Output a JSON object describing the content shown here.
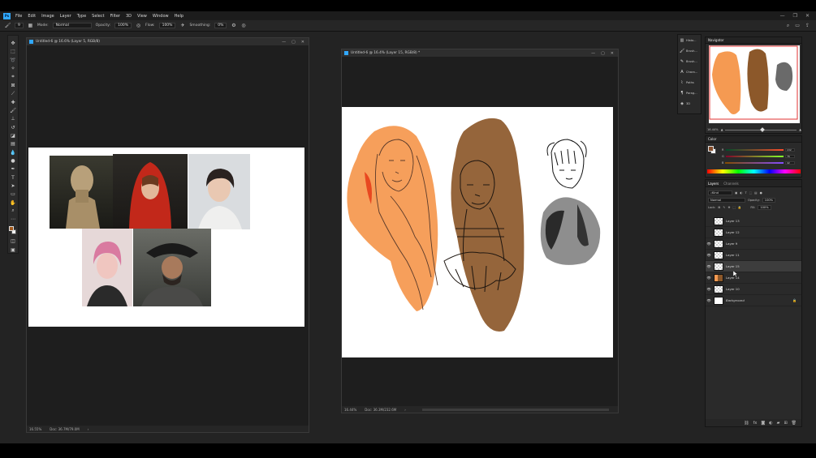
{
  "app": {
    "logo": "Ps",
    "menu": [
      "File",
      "Edit",
      "Image",
      "Layer",
      "Type",
      "Select",
      "Filter",
      "3D",
      "View",
      "Window",
      "Help"
    ],
    "window_controls": [
      "—",
      "❐",
      "✕"
    ]
  },
  "options_bar": {
    "brush_size": "9",
    "mode_label": "Mode:",
    "mode_value": "Normal",
    "opacity_label": "Opacity:",
    "opacity_value": "100%",
    "flow_label": "Flow:",
    "flow_value": "100%",
    "smoothing_label": "Smoothing:",
    "smoothing_value": "0%"
  },
  "doc1": {
    "title": "Untitled-6 @ 16.6% (Layer 5, RGB/8)",
    "zoom": "16.55%",
    "doc_info": "Doc: 36.7M/79.0M"
  },
  "doc2": {
    "title": "Untitled-6 @ 16.4% (Layer 15, RGB/8) *",
    "zoom": "16.44%",
    "doc_info": "Doc: 36.3M/232.6M"
  },
  "mini_panel": {
    "items": [
      "Histo...",
      "Brush...",
      "Brush...",
      "Chara...",
      "Paths",
      "Parag...",
      "3D"
    ]
  },
  "navigator": {
    "tab": "Navigator",
    "zoom": "16.44%"
  },
  "color": {
    "tab": "Color",
    "r_label": "R",
    "g_label": "G",
    "b_label": "B",
    "r_value": "132",
    "g_value": "76",
    "b_value": "42",
    "fg_color": "#844c2a"
  },
  "layers": {
    "tabs": [
      "Layers",
      "Channels"
    ],
    "filter_kind": "Kind",
    "blend_mode": "Normal",
    "opacity_label": "Opacity:",
    "opacity_value": "100%",
    "lock_label": "Lock:",
    "fill_label": "Fill:",
    "fill_value": "100%",
    "items": [
      {
        "name": "Layer 13",
        "visible": false
      },
      {
        "name": "Layer 12",
        "visible": false
      },
      {
        "name": "Layer 9",
        "visible": true
      },
      {
        "name": "Layer 11",
        "visible": true
      },
      {
        "name": "Layer 15",
        "visible": true
      },
      {
        "name": "Layer 14",
        "visible": true
      },
      {
        "name": "Layer 10",
        "visible": true
      },
      {
        "name": "Background",
        "visible": true
      }
    ]
  },
  "colors": {
    "accent": "#31a8ff",
    "orange_paint": "#f4994f",
    "brown_paint": "#8e5a2b"
  }
}
